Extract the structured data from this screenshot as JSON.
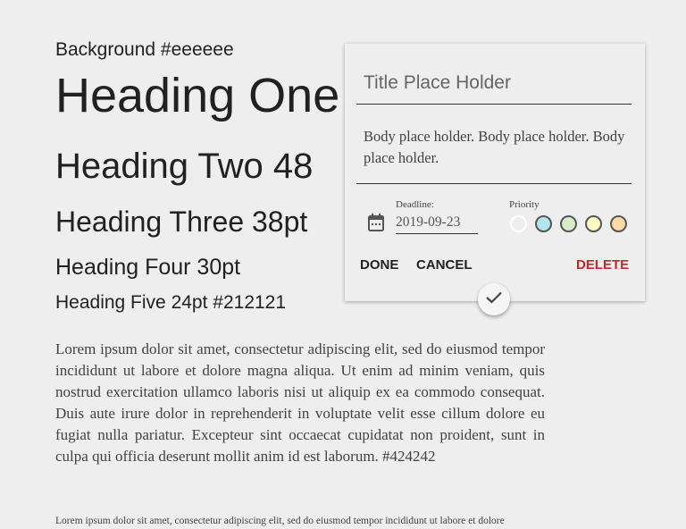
{
  "page": {
    "background_label": "Background #eeeeee",
    "heading_one": "Heading One",
    "heading_two": "Heading Two 48",
    "heading_three": "Heading Three 38pt",
    "heading_four": "Heading Four 30pt",
    "heading_five": "Heading Five 24pt #212121",
    "body_text": "Lorem ipsum dolor sit amet, consectetur adipiscing elit, sed do eiusmod tempor incididunt ut labore et dolore magna aliqua. Ut enim ad minim veniam, quis nostrud exercitation ullamco laboris nisi ut aliquip ex ea commodo consequat. Duis aute irure dolor in reprehenderit in voluptate velit esse cillum dolore eu fugiat nulla pariatur. Excepteur sint occaecat cupidatat non proident, sunt in culpa qui officia deserunt mollit anim id est laborum. #424242",
    "small_text": "Lorem ipsum dolor sit amet, consectetur adipiscing elit, sed do eiusmod tempor incididunt ut labore et dolore"
  },
  "card": {
    "title_placeholder": "Title Place Holder",
    "body_placeholder": "Body place holder. Body place holder. Body place holder.",
    "deadline_label": "Deadline:",
    "deadline_value": "2019-09-23",
    "priority_label": "Priority",
    "priority_colors": [
      "#eeeeee",
      "#b3e5f0",
      "#d8ecc8",
      "#fff9c4",
      "#ffd8a8"
    ],
    "done": "DONE",
    "cancel": "CANCEL",
    "delete": "DELETE",
    "delete_color": "#c62828"
  }
}
